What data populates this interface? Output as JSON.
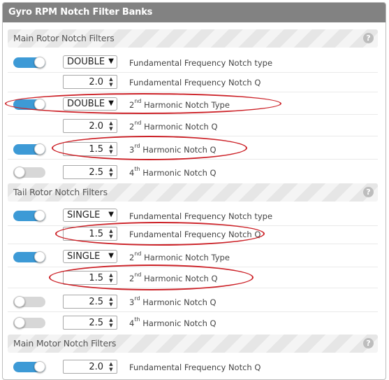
{
  "panel": {
    "title": "Gyro RPM Notch Filter Banks"
  },
  "help_glyph": "?",
  "sections": {
    "main_rotor": "Main Rotor Notch Filters",
    "tail_rotor": "Tail Rotor Notch Filters",
    "main_motor": "Main Motor Notch Filters"
  },
  "main_rotor": {
    "type_enabled": true,
    "type_value": "DOUBLE",
    "type_label": "Fundamental Frequency Notch type",
    "q_value": "2.0",
    "q_label": "Fundamental Frequency Notch Q",
    "h2_type_enabled": true,
    "h2_type_value": "DOUBLE",
    "h2_type_ord": "2",
    "h2_type_sup": "nd",
    "h2_type_label": " Harmonic Notch Type",
    "h2_q_value": "2.0",
    "h2_q_ord": "2",
    "h2_q_sup": "nd",
    "h2_q_label": " Harmonic Notch Q",
    "h3_enabled": true,
    "h3_value": "1.5",
    "h3_ord": "3",
    "h3_sup": "rd",
    "h3_label": " Harmonic Notch Q",
    "h4_enabled": false,
    "h4_value": "2.5",
    "h4_ord": "4",
    "h4_sup": "th",
    "h4_label": " Harmonic Notch Q"
  },
  "tail_rotor": {
    "type_enabled": true,
    "type_value": "SINGLE",
    "type_label": "Fundamental Frequency Notch type",
    "q_value": "1.5",
    "q_label": "Fundamental Frequency Notch Q",
    "h2_type_enabled": true,
    "h2_type_value": "SINGLE",
    "h2_type_ord": "2",
    "h2_type_sup": "nd",
    "h2_type_label": " Harmonic Notch Type",
    "h2_q_value": "1.5",
    "h2_q_ord": "2",
    "h2_q_sup": "nd",
    "h2_q_label": " Harmonic Notch Q",
    "h3_enabled": false,
    "h3_value": "2.5",
    "h3_ord": "3",
    "h3_sup": "rd",
    "h3_label": " Harmonic Notch Q",
    "h4_enabled": false,
    "h4_value": "2.5",
    "h4_ord": "4",
    "h4_sup": "th",
    "h4_label": " Harmonic Notch Q"
  },
  "main_motor": {
    "q_enabled": true,
    "q_value": "2.0",
    "q_label": "Fundamental Frequency Notch Q"
  },
  "icons": {
    "chevron": "chevron-down-icon",
    "spin_up": "spin-up-icon",
    "spin_down": "spin-down-icon",
    "help": "help-icon"
  },
  "colors": {
    "header_bg": "#828282",
    "toggle_on": "#3d9ad6",
    "toggle_off": "#d7d7d7",
    "annotation": "#cc2127"
  }
}
